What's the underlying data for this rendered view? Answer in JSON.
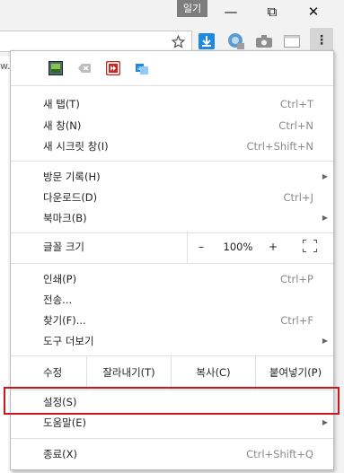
{
  "window": {
    "title_label": "일기",
    "minimize": "—",
    "restore": "⧉",
    "close": "✕"
  },
  "toolbar": {
    "url_fragment": "w.c",
    "icons": [
      "star-icon",
      "download-extension-icon",
      "globe-extension-icon",
      "camera-extension-icon",
      "window-extension-icon"
    ],
    "menu_label": "⋮"
  },
  "extensions": [
    "image-extension-icon",
    "delete-extension-icon",
    "record-extension-icon",
    "translate-extension-icon"
  ],
  "menu": {
    "new_tab": {
      "label": "새 탭(T)",
      "shortcut": "Ctrl+T"
    },
    "new_window": {
      "label": "새 창(N)",
      "shortcut": "Ctrl+N"
    },
    "incognito": {
      "label": "새 시크릿 창(I)",
      "shortcut": "Ctrl+Shift+N"
    },
    "history": {
      "label": "방문 기록(H)"
    },
    "downloads": {
      "label": "다운로드(D)",
      "shortcut": "Ctrl+J"
    },
    "bookmarks": {
      "label": "북마크(B)"
    },
    "zoom": {
      "label": "글꼴 크기",
      "minus": "–",
      "value": "100%",
      "plus": "+"
    },
    "print": {
      "label": "인쇄(P)",
      "shortcut": "Ctrl+P"
    },
    "cast": {
      "label": "전송..."
    },
    "find": {
      "label": "찾기(F)...",
      "shortcut": "Ctrl+F"
    },
    "more_tools": {
      "label": "도구 더보기"
    },
    "edit": {
      "label": "수정",
      "cut": "잘라내기(T)",
      "copy": "복사(C)",
      "paste": "붙여넣기(P)"
    },
    "settings": {
      "label": "설정(S)"
    },
    "help": {
      "label": "도움말(E)"
    },
    "exit": {
      "label": "종료(X)",
      "shortcut": "Ctrl+Shift+Q"
    }
  },
  "colors": {
    "highlight": "#c8181e",
    "accent_blue": "#1e88e5"
  }
}
